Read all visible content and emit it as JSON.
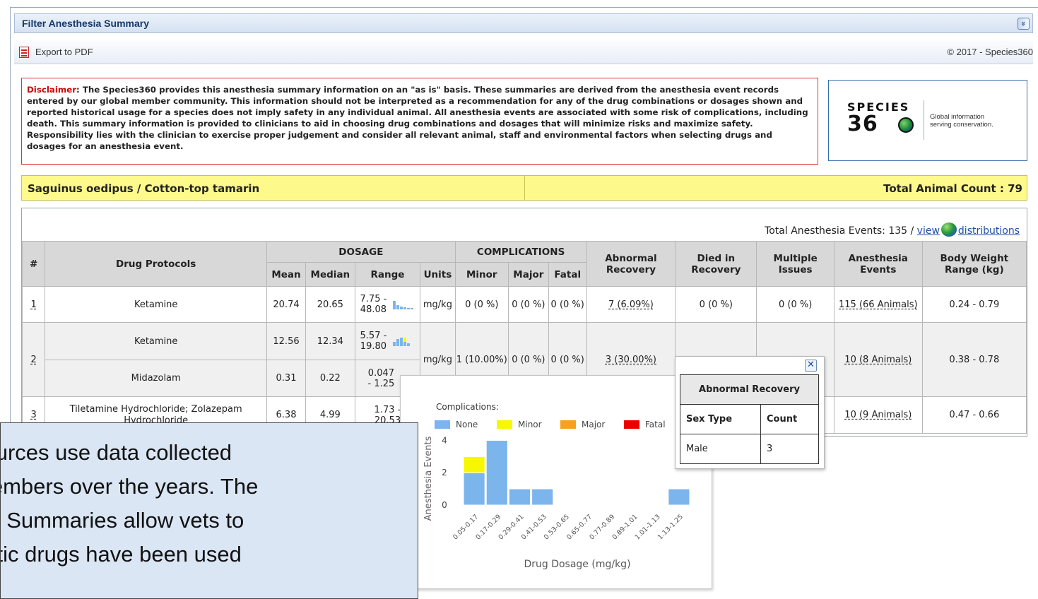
{
  "filter": {
    "title": "Filter Anesthesia Summary",
    "collapse_icon": "»"
  },
  "toolbar": {
    "export_label": "Export to PDF",
    "copyright": "© 2017 - Species360"
  },
  "disclaimer": {
    "label": "Disclaimer",
    "text": ": The Species360 provides this anesthesia summary information on an \"as is\" basis. These summaries are derived from the anesthesia event records entered by our global member community. This information should not be interpreted as a recommendation for any of the drug combinations or dosages shown and reported historical usage for a species does not imply safety in any individual animal. All anesthesia events are associated with some risk of complications, including death. This summary information is provided to clinicians to aid in choosing drug combinations and dosages that will minimize risks and maximize safety. Responsibility lies with the clinician to exercise proper judgement and consider all relevant animal, staff and environmental factors when selecting drugs and dosages for an anesthesia event."
  },
  "logo": {
    "name": "SPECIES",
    "number": "36",
    "tagline": "Global information serving conservation."
  },
  "species": {
    "name": "Saguinus oedipus / Cotton-top tamarin",
    "animal_count": "Total Animal Count : 79"
  },
  "summary": {
    "events_label": "Total Anesthesia Events",
    "events_value": ": 135 / ",
    "view_link": "view",
    "dist_link": "distributions"
  },
  "table": {
    "headers": {
      "num": "#",
      "protocols": "Drug Protocols",
      "dosage": "DOSAGE",
      "complications": "COMPLICATIONS",
      "abnormal": "Abnormal Recovery",
      "died": "Died in Recovery",
      "multiple": "Multiple Issues",
      "events": "Anesthesia Events",
      "weight": "Body Weight Range (kg)",
      "mean": "Mean",
      "median": "Median",
      "range": "Range",
      "units": "Units",
      "minor": "Minor",
      "major": "Major",
      "fatal": "Fatal"
    },
    "rows": [
      {
        "num": "1",
        "drug": "Ketamine",
        "mean": "20.74",
        "median": "20.65",
        "range": "7.75 - 48.08",
        "units": "mg/kg",
        "minor": "0 (0 %)",
        "major": "0 (0 %)",
        "fatal": "0 (0 %)",
        "abnormal": "7 (6.09%)",
        "died": "0 (0 %)",
        "multiple": "0 (0 %)",
        "events": "115 (66 Animals)",
        "weight": "0.24 - 0.79"
      },
      {
        "num": "2",
        "drug": "Ketamine",
        "mean": "12.56",
        "median": "12.34",
        "range": "5.57 - 19.80",
        "units": "mg/kg",
        "minor": "1 (10.00%)",
        "major": "0 (0 %)",
        "fatal": "0 (0 %)",
        "abnormal": "3 (30.00%)",
        "died": "",
        "multiple": "",
        "events": "10 (8 Animals)",
        "weight": "0.38 - 0.78"
      },
      {
        "drug": "Midazolam",
        "mean": "0.31",
        "median": "0.22",
        "range": "0.047 - 1.25"
      },
      {
        "num": "3",
        "drug": "Tiletamine Hydrochloride; Zolazepam Hydrochloride",
        "mean": "6.38",
        "median": "4.99",
        "range": "1.73 - 20.53",
        "events": "10 (9 Animals)",
        "weight": "0.47 - 0.66"
      }
    ]
  },
  "recovery_popup": {
    "title": "Abnormal Recovery",
    "col_sex": "Sex Type",
    "col_count": "Count",
    "sex": "Male",
    "count": "3",
    "close_icon": "✕"
  },
  "chart_data": {
    "type": "bar",
    "title": "",
    "legend_title": "Complications:",
    "xlabel": "Drug Dosage (mg/kg)",
    "ylabel": "Anesthesia Events",
    "categories": [
      "0.05-0.17",
      "0.17-0.29",
      "0.29-0.41",
      "0.41-0.53",
      "0.53-0.65",
      "0.65-0.77",
      "0.77-0.89",
      "0.89-1.01",
      "1.01-1.13",
      "1.13-1.25"
    ],
    "series": [
      {
        "name": "None",
        "color": "#7cb5ec",
        "values": [
          2,
          4,
          1,
          1,
          0,
          0,
          0,
          0,
          0,
          1
        ]
      },
      {
        "name": "Minor",
        "color": "#f7f700",
        "values": [
          1,
          0,
          0,
          0,
          0,
          0,
          0,
          0,
          0,
          0
        ]
      },
      {
        "name": "Major",
        "color": "#f7a21b",
        "values": [
          0,
          0,
          0,
          0,
          0,
          0,
          0,
          0,
          0,
          0
        ]
      },
      {
        "name": "Fatal",
        "color": "#ee0000",
        "values": [
          0,
          0,
          0,
          0,
          0,
          0,
          0,
          0,
          0,
          0
        ]
      }
    ],
    "yticks": [
      "0",
      "2",
      "4"
    ],
    "ylim": [
      0,
      4.5
    ],
    "stacked": true
  },
  "caption": {
    "line1": "sources use data collected",
    "line2": "members over the years. The",
    "line3": "sia Summaries allow vets to",
    "line4": "hetic drugs have been used"
  }
}
